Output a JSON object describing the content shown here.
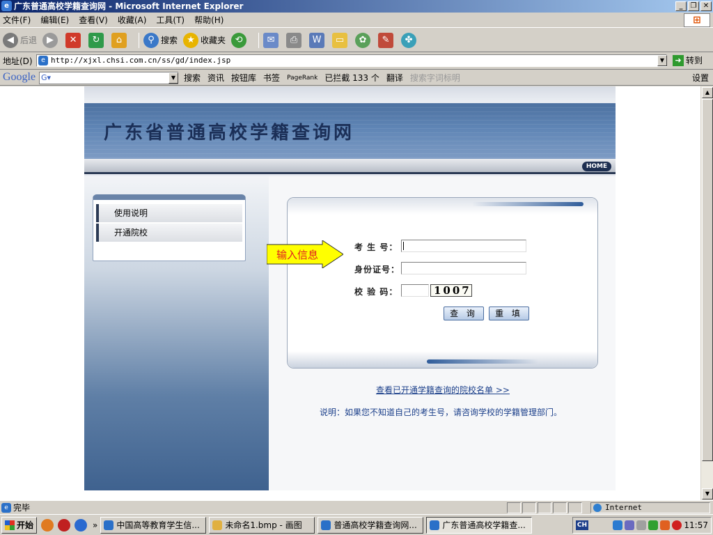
{
  "window": {
    "title": "广东普通高校学籍查询网 - Microsoft Internet Explorer",
    "buttons": [
      "_",
      "❐",
      "✕"
    ]
  },
  "menubar": {
    "items": [
      "文件(F)",
      "编辑(E)",
      "查看(V)",
      "收藏(A)",
      "工具(T)",
      "帮助(H)"
    ]
  },
  "toolbar": {
    "back": "后退",
    "search": "搜索",
    "favorites": "收藏夹"
  },
  "address": {
    "label": "地址(D)",
    "url": "http://xjxl.chsi.com.cn/ss/gd/index.jsp",
    "go": "转到"
  },
  "googlebar": {
    "logo": "Google",
    "search": "搜索",
    "news": "资讯",
    "buttons": "按钮库",
    "bookmarks": "书签",
    "pagerank": "PageRank",
    "blocked": "已拦截 133 个",
    "translate": "翻译",
    "highlight": "搜索字词标明",
    "settings": "设置"
  },
  "site": {
    "title": "广东省普通高校学籍查询网",
    "home": "HOME",
    "menu": [
      "使用说明",
      "开通院校"
    ],
    "callout": "输入信息",
    "form": {
      "candidate_label": "考 生 号：",
      "id_label": "身份证号：",
      "captcha_label": "校 验 码：",
      "captcha_value": "1007",
      "submit": "查 询",
      "reset": "重 填"
    },
    "link": "查看已开通学籍查询的院校名单 >>",
    "note": "说明：如果您不知道自己的考生号，请咨询学校的学籍管理部门。"
  },
  "statusbar": {
    "text": "完毕",
    "zone": "Internet"
  },
  "taskbar": {
    "start": "开始",
    "tasks": [
      "中国高等教育学生信...",
      "未命名1.bmp - 画图",
      "普通高校学籍查询网...",
      "广东普通高校学籍查..."
    ],
    "clock": "11:57",
    "ime": "CH"
  }
}
